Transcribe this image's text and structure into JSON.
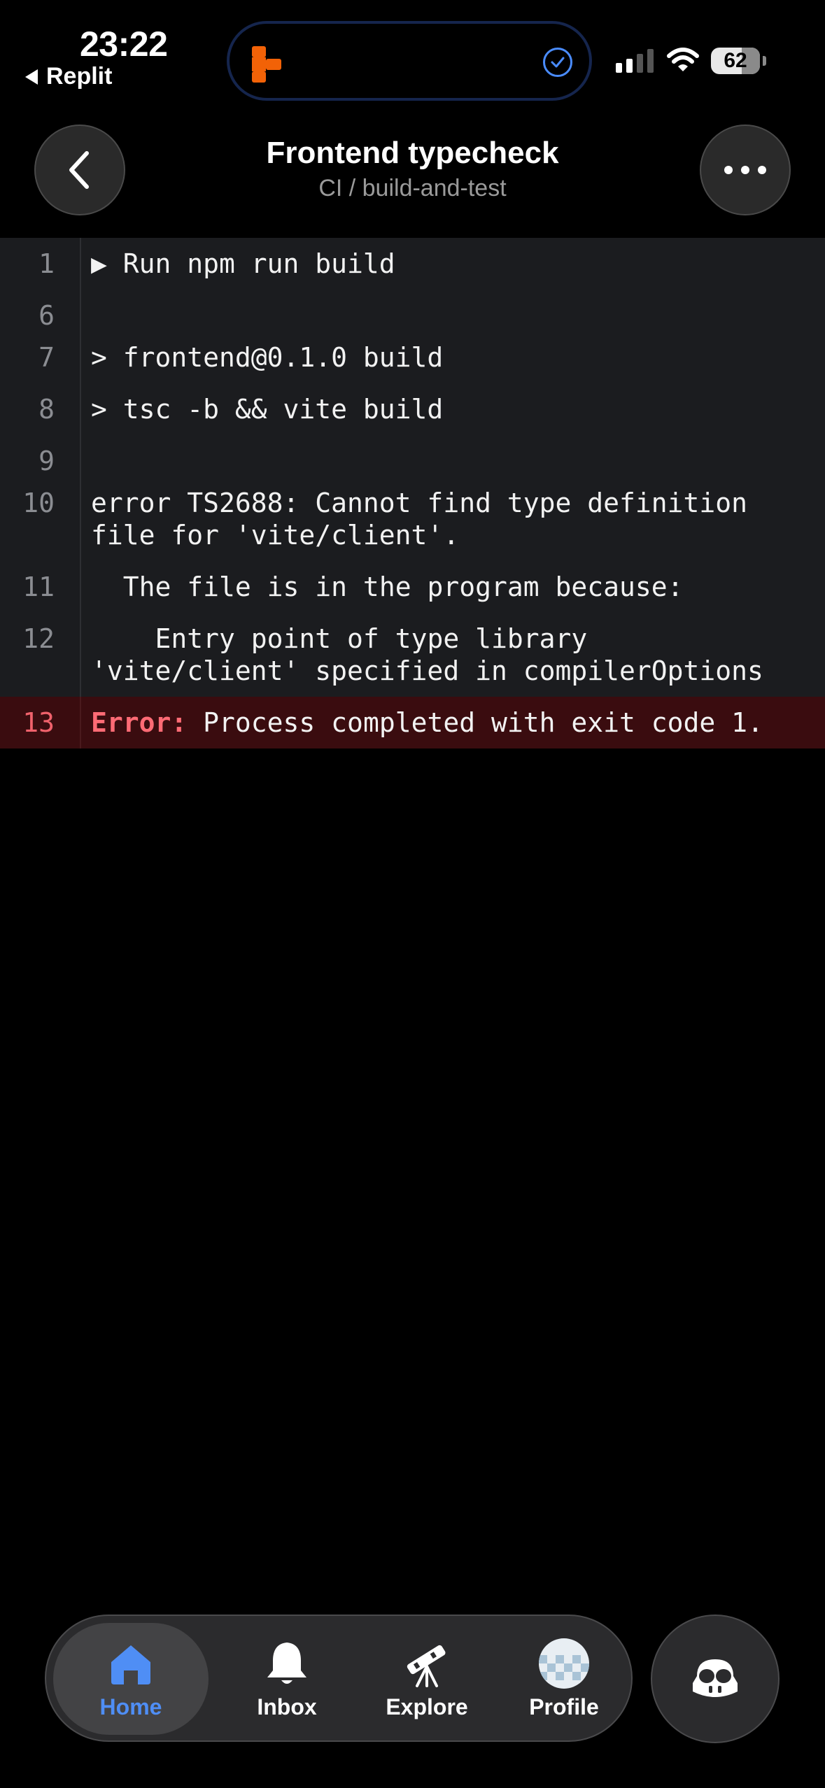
{
  "status_bar": {
    "time": "23:22",
    "back_app": "Replit",
    "battery": "62"
  },
  "header": {
    "title": "Frontend typecheck",
    "subtitle": "CI / build-and-test"
  },
  "log": {
    "lines": [
      {
        "num": "1",
        "text": "▶ Run npm run build"
      },
      {
        "num": "6",
        "text": ""
      },
      {
        "num": "7",
        "text": "> frontend@0.1.0 build"
      },
      {
        "num": "8",
        "text": "> tsc -b && vite build"
      },
      {
        "num": "9",
        "text": ""
      },
      {
        "num": "10",
        "text": "error TS2688: Cannot find type definition file for 'vite/client'."
      },
      {
        "num": "11",
        "text": "  The file is in the program because:"
      },
      {
        "num": "12",
        "text": "    Entry point of type library 'vite/client' specified in compilerOptions"
      }
    ],
    "error_line": {
      "num": "13",
      "prefix": "Error:",
      "text": " Process completed with exit code 1."
    }
  },
  "tabbar": {
    "items": [
      {
        "label": "Home",
        "icon": "home-icon",
        "active": true
      },
      {
        "label": "Inbox",
        "icon": "bell-icon",
        "active": false
      },
      {
        "label": "Explore",
        "icon": "telescope-icon",
        "active": false
      },
      {
        "label": "Profile",
        "icon": "avatar",
        "active": false
      }
    ]
  },
  "colors": {
    "accent": "#4f8ef5",
    "error": "#ff6b75",
    "error_bg": "#3a0c0f",
    "log_bg": "#1b1c1f",
    "replit_orange": "#f26207"
  }
}
